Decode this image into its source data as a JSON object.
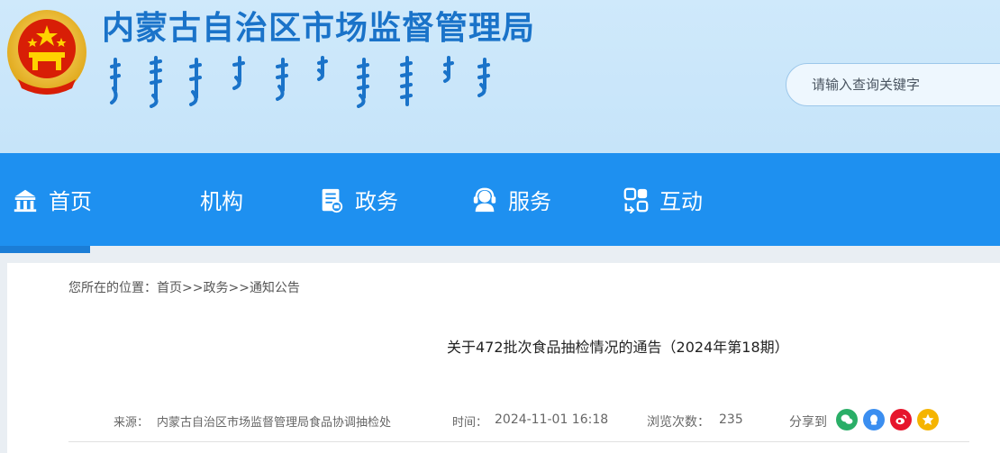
{
  "header": {
    "site_title": "内蒙古自治区市场监督管理局",
    "search_placeholder": "请输入查询关键字"
  },
  "nav": {
    "items": [
      {
        "label": "首页",
        "icon": "building-icon"
      },
      {
        "label": "机构",
        "icon": ""
      },
      {
        "label": "政务",
        "icon": "document-icon"
      },
      {
        "label": "服务",
        "icon": "headset-icon"
      },
      {
        "label": "互动",
        "icon": "exchange-icon"
      }
    ]
  },
  "breadcrumb": {
    "prefix": "您所在的位置：",
    "home": "首页",
    "sep1": ">>",
    "section": "政务",
    "sep2": ">>",
    "current": "通知公告"
  },
  "article": {
    "title": "关于472批次食品抽检情况的通告（2024年第18期）",
    "source_label": "来源：",
    "source": "内蒙古自治区市场监督管理局食品协调抽检处",
    "time_label": "时间：",
    "time": "2024-11-01 16:18",
    "views_label": "浏览次数：",
    "views": "235",
    "share_label": "分享到"
  },
  "colors": {
    "header_bg": "#cfe9fb",
    "title_blue": "#1a73c9",
    "nav_bg": "#1e90f0",
    "wechat": "#2aae67",
    "qq": "#3b8ef0",
    "weibo": "#e6162d",
    "qzone": "#f5b400"
  }
}
